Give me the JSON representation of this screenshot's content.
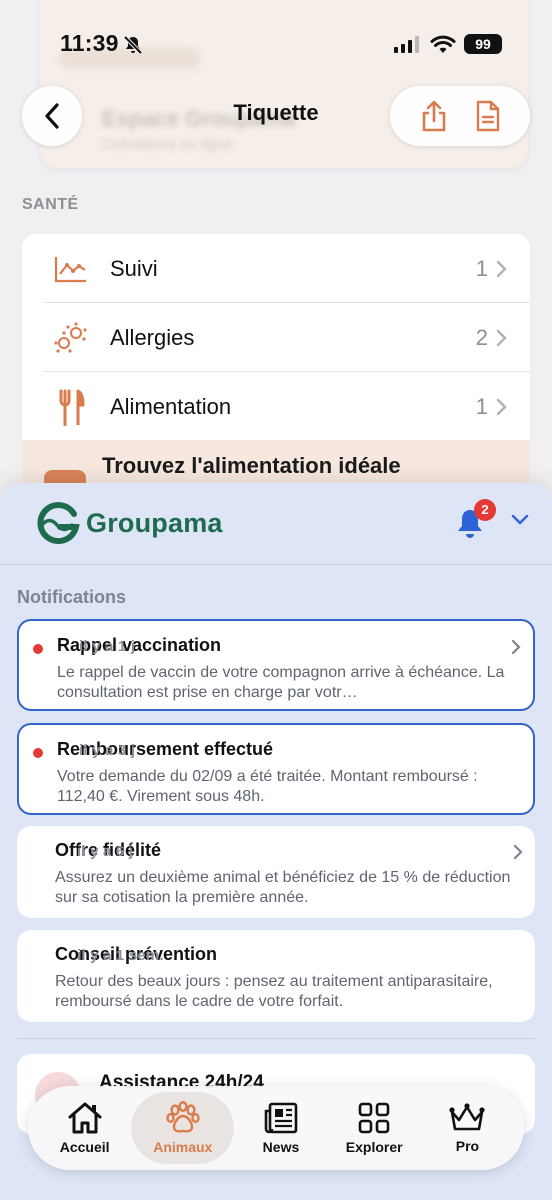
{
  "status_bar": {
    "time": "11:39",
    "battery": "99"
  },
  "nav": {
    "title": "Tiquette"
  },
  "background_blurred": {
    "line1": "Espace Groupama",
    "line2": "Cotisations en ligne"
  },
  "health": {
    "section_label": "SANTÉ",
    "items": [
      {
        "label": "Suivi",
        "count": "1",
        "icon": "chart-line-icon"
      },
      {
        "label": "Allergies",
        "count": "2",
        "icon": "pollen-icon"
      },
      {
        "label": "Alimentation",
        "count": "1",
        "icon": "fork-knife-icon"
      }
    ],
    "promo": "Trouvez l'alimentation idéale"
  },
  "sheet": {
    "brand": "Groupama",
    "badge_count": "2",
    "heading": "Notifications",
    "notifications": [
      {
        "title": "Rappel vaccination",
        "time": "il y a 1 j",
        "body": "Le rappel de vaccin de votre compagnon arrive à échéance. La consultation est prise en charge par votr…",
        "unread": true
      },
      {
        "title": "Remboursement effectué",
        "time": "il y a 3 j",
        "body": "Votre demande du 02/09 a été traitée. Montant remboursé : 112,40 €. Virement sous 48h.",
        "unread": true
      },
      {
        "title": "Offre fidélité",
        "time": "il y a 6 j",
        "body": "Assurez un deuxième animal et bénéficiez de 15 % de réduction sur sa cotisation la première année.",
        "unread": false
      },
      {
        "title": "Conseil prévention",
        "time": "il y a 1 sem.",
        "body": "Retour des beaux jours : pensez au traitement antiparasitaire, remboursé dans le cadre de votre forfait.",
        "unread": false
      }
    ],
    "assistance_title": "Assistance 24h/24"
  },
  "tabbar": {
    "tabs": [
      {
        "label": "Accueil",
        "icon": "home-icon"
      },
      {
        "label": "Animaux",
        "icon": "paw-icon",
        "active": true
      },
      {
        "label": "News",
        "icon": "newspaper-icon"
      },
      {
        "label": "Explorer",
        "icon": "grid-icon"
      },
      {
        "label": "Pro",
        "icon": "crown-icon"
      }
    ]
  },
  "colors": {
    "accent": "#d97b4d",
    "brand_green": "#1f6b4e",
    "unread_border": "#3463c9",
    "badge_red": "#e53935",
    "sheet_bg": "#dde5f7"
  }
}
